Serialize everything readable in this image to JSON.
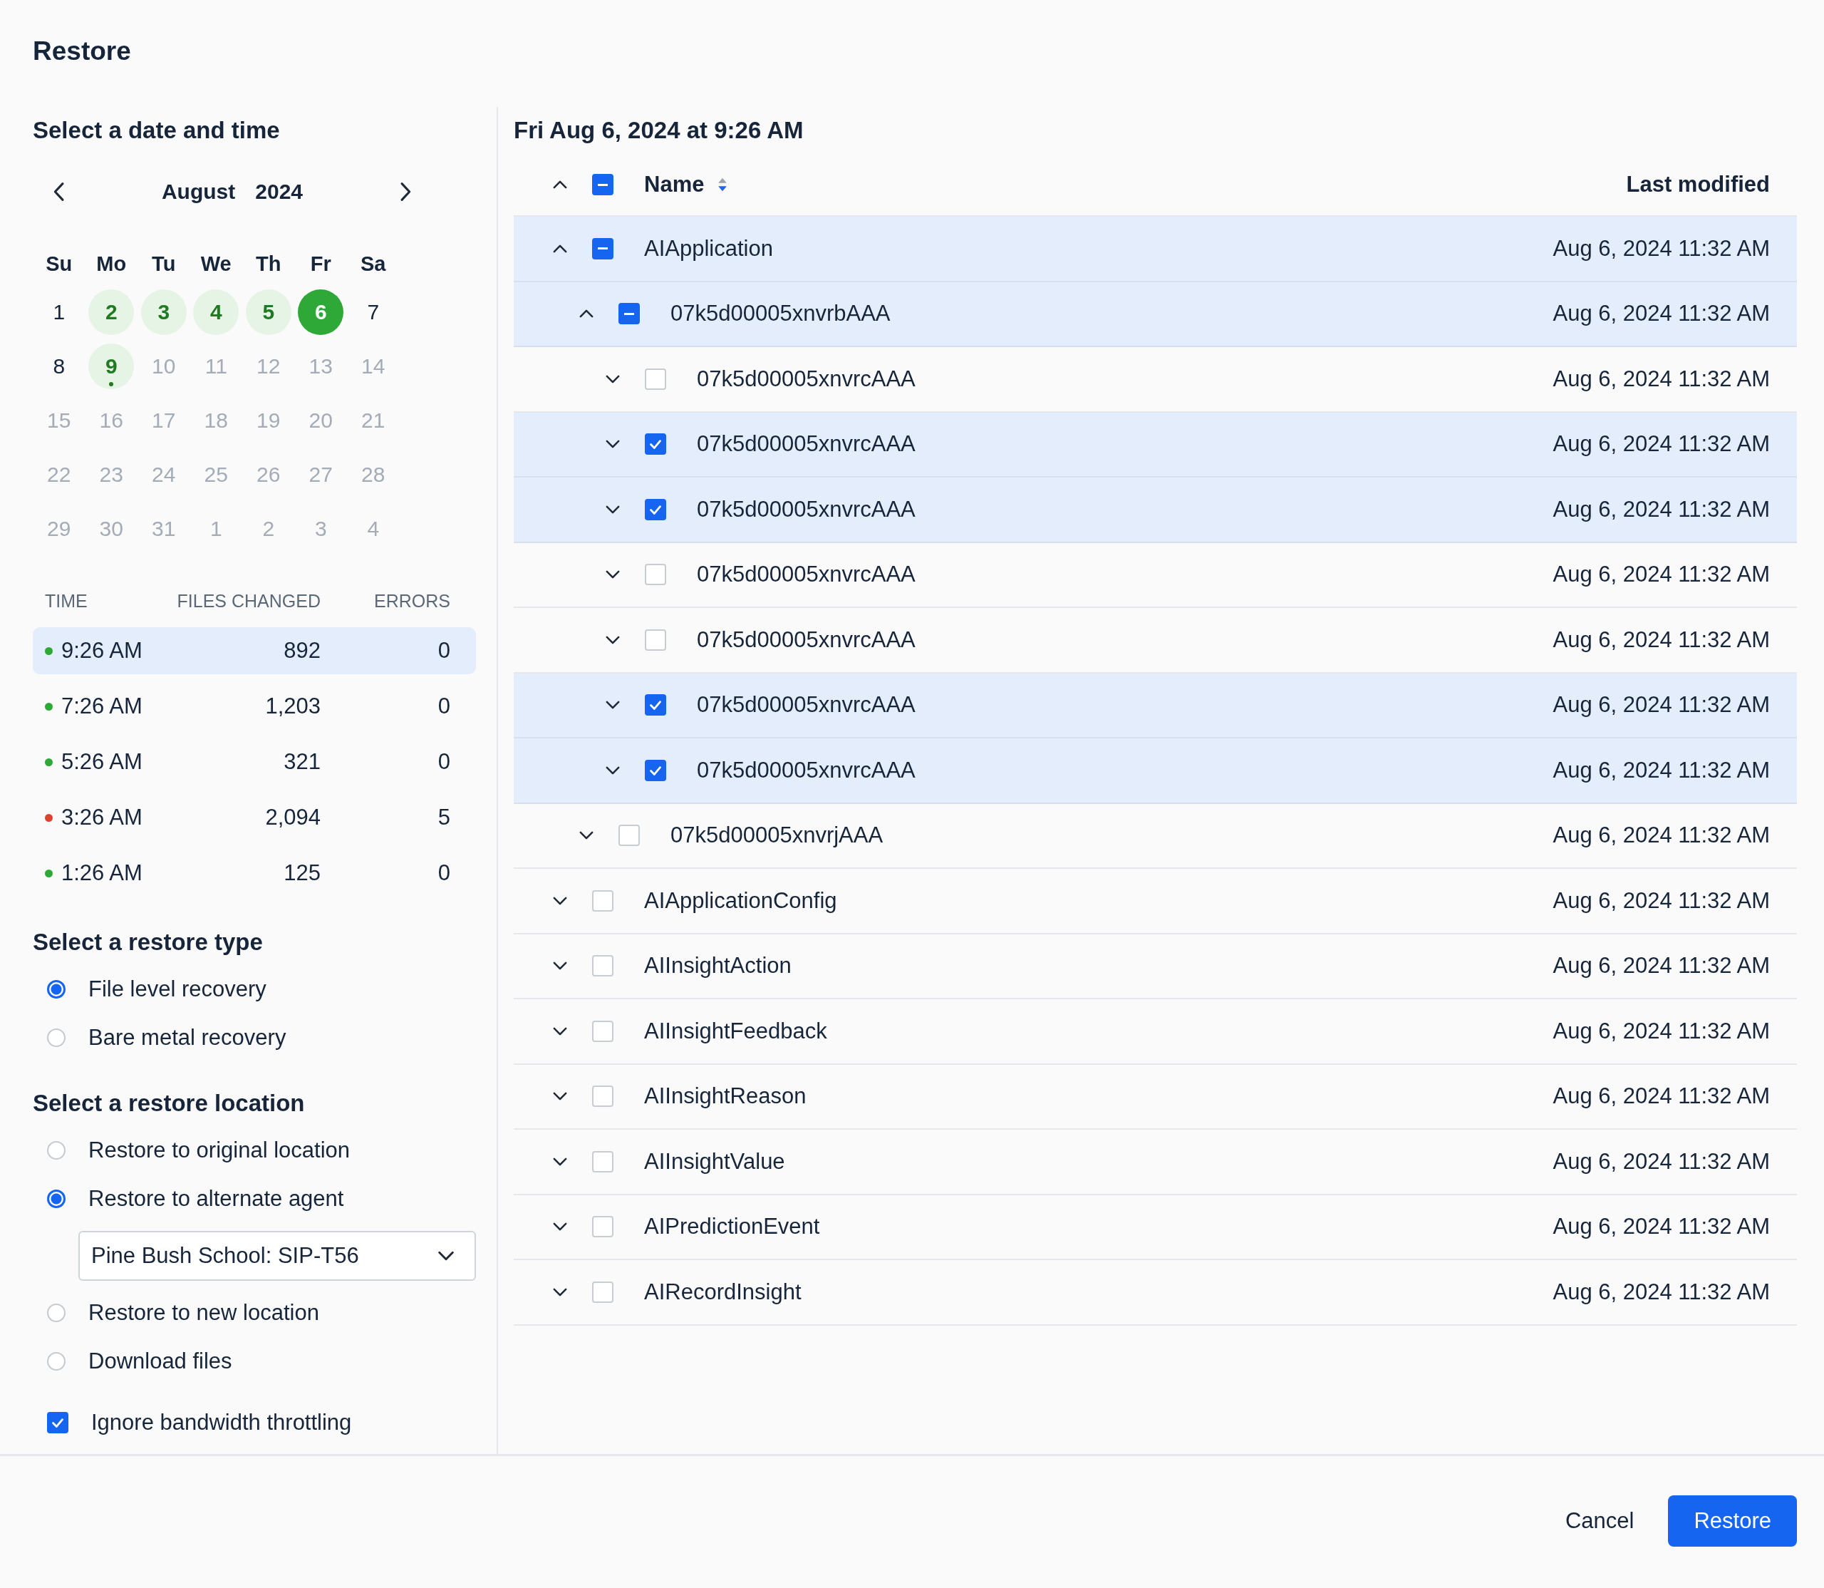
{
  "window": {
    "title": "Restore"
  },
  "date_section": {
    "heading": "Select a date and time",
    "month": "August",
    "year": "2024",
    "weekdays": [
      "Su",
      "Mo",
      "Tu",
      "We",
      "Th",
      "Fr",
      "Sa"
    ],
    "weeks": [
      [
        {
          "label": "1",
          "disabled": false,
          "has_backups": false,
          "selected": false,
          "today": false
        },
        {
          "label": "2",
          "disabled": false,
          "has_backups": true,
          "selected": false,
          "today": false
        },
        {
          "label": "3",
          "disabled": false,
          "has_backups": true,
          "selected": false,
          "today": false
        },
        {
          "label": "4",
          "disabled": false,
          "has_backups": true,
          "selected": false,
          "today": false
        },
        {
          "label": "5",
          "disabled": false,
          "has_backups": true,
          "selected": false,
          "today": false
        },
        {
          "label": "6",
          "disabled": false,
          "has_backups": true,
          "selected": true,
          "today": false
        },
        {
          "label": "7",
          "disabled": false,
          "has_backups": false,
          "selected": false,
          "today": false
        }
      ],
      [
        {
          "label": "8",
          "disabled": false,
          "has_backups": false,
          "selected": false,
          "today": false
        },
        {
          "label": "9",
          "disabled": false,
          "has_backups": true,
          "selected": false,
          "today": true
        },
        {
          "label": "10",
          "disabled": true,
          "has_backups": false,
          "selected": false,
          "today": false
        },
        {
          "label": "11",
          "disabled": true,
          "has_backups": false,
          "selected": false,
          "today": false
        },
        {
          "label": "12",
          "disabled": true,
          "has_backups": false,
          "selected": false,
          "today": false
        },
        {
          "label": "13",
          "disabled": true,
          "has_backups": false,
          "selected": false,
          "today": false
        },
        {
          "label": "14",
          "disabled": true,
          "has_backups": false,
          "selected": false,
          "today": false
        }
      ],
      [
        {
          "label": "15",
          "disabled": true,
          "has_backups": false,
          "selected": false,
          "today": false
        },
        {
          "label": "16",
          "disabled": true,
          "has_backups": false,
          "selected": false,
          "today": false
        },
        {
          "label": "17",
          "disabled": true,
          "has_backups": false,
          "selected": false,
          "today": false
        },
        {
          "label": "18",
          "disabled": true,
          "has_backups": false,
          "selected": false,
          "today": false
        },
        {
          "label": "19",
          "disabled": true,
          "has_backups": false,
          "selected": false,
          "today": false
        },
        {
          "label": "20",
          "disabled": true,
          "has_backups": false,
          "selected": false,
          "today": false
        },
        {
          "label": "21",
          "disabled": true,
          "has_backups": false,
          "selected": false,
          "today": false
        }
      ],
      [
        {
          "label": "22",
          "disabled": true,
          "has_backups": false,
          "selected": false,
          "today": false
        },
        {
          "label": "23",
          "disabled": true,
          "has_backups": false,
          "selected": false,
          "today": false
        },
        {
          "label": "24",
          "disabled": true,
          "has_backups": false,
          "selected": false,
          "today": false
        },
        {
          "label": "25",
          "disabled": true,
          "has_backups": false,
          "selected": false,
          "today": false
        },
        {
          "label": "26",
          "disabled": true,
          "has_backups": false,
          "selected": false,
          "today": false
        },
        {
          "label": "27",
          "disabled": true,
          "has_backups": false,
          "selected": false,
          "today": false
        },
        {
          "label": "28",
          "disabled": true,
          "has_backups": false,
          "selected": false,
          "today": false
        }
      ],
      [
        {
          "label": "29",
          "disabled": true,
          "has_backups": false,
          "selected": false,
          "today": false
        },
        {
          "label": "30",
          "disabled": true,
          "has_backups": false,
          "selected": false,
          "today": false
        },
        {
          "label": "31",
          "disabled": true,
          "has_backups": false,
          "selected": false,
          "today": false
        },
        {
          "label": "1",
          "disabled": true,
          "has_backups": false,
          "selected": false,
          "today": false
        },
        {
          "label": "2",
          "disabled": true,
          "has_backups": false,
          "selected": false,
          "today": false
        },
        {
          "label": "3",
          "disabled": true,
          "has_backups": false,
          "selected": false,
          "today": false
        },
        {
          "label": "4",
          "disabled": true,
          "has_backups": false,
          "selected": false,
          "today": false
        }
      ]
    ]
  },
  "snapshots": {
    "columns": [
      "TIME",
      "FILES CHANGED",
      "ERRORS"
    ],
    "rows": [
      {
        "time": "9:26 AM",
        "files_changed": "892",
        "errors": "0",
        "color": "#2ea836",
        "selected": true
      },
      {
        "time": "7:26 AM",
        "files_changed": "1,203",
        "errors": "0",
        "color": "#2ea836",
        "selected": false
      },
      {
        "time": "5:26 AM",
        "files_changed": "321",
        "errors": "0",
        "color": "#2ea836",
        "selected": false
      },
      {
        "time": "3:26 AM",
        "files_changed": "2,094",
        "errors": "5",
        "color": "#d9432f",
        "selected": false
      },
      {
        "time": "1:26 AM",
        "files_changed": "125",
        "errors": "0",
        "color": "#2ea836",
        "selected": false
      }
    ]
  },
  "restore_type": {
    "heading": "Select a restore type",
    "options": [
      {
        "label": "File level recovery",
        "selected": true
      },
      {
        "label": "Bare metal recovery",
        "selected": false
      }
    ]
  },
  "restore_location": {
    "heading": "Select a restore location",
    "options": [
      {
        "label": "Restore to original location",
        "selected": false
      },
      {
        "label": "Restore to alternate agent",
        "selected": true,
        "dropdown": "Pine Bush School: SIP-T56"
      },
      {
        "label": "Restore to new location",
        "selected": false
      },
      {
        "label": "Download files",
        "selected": false
      }
    ]
  },
  "ignore_throttling": {
    "label": "Ignore bandwidth throttling",
    "checked": true
  },
  "file_tree": {
    "heading": "Fri Aug 6, 2024 at 9:26 AM",
    "header": {
      "expanded": true,
      "checked": true,
      "partial": true,
      "name": "Name",
      "last_modified": "Last modified"
    },
    "items": [
      {
        "name": "AIApplication",
        "modified": "Aug 6, 2024 11:32 AM",
        "expanded": true,
        "checked": true,
        "partial": true,
        "children": [
          {
            "name": "07k5d00005xnvrbAAA",
            "modified": "Aug 6, 2024 11:32 AM",
            "expanded": true,
            "checked": true,
            "partial": true,
            "children": [
              {
                "name": "07k5d00005xnvrcAAA",
                "modified": "Aug 6, 2024 11:32 AM",
                "expanded": false,
                "checked": false,
                "partial": false
              },
              {
                "name": "07k5d00005xnvrcAAA",
                "modified": "Aug 6, 2024 11:32 AM",
                "expanded": false,
                "checked": true,
                "partial": false
              },
              {
                "name": "07k5d00005xnvrcAAA",
                "modified": "Aug 6, 2024 11:32 AM",
                "expanded": false,
                "checked": true,
                "partial": false
              },
              {
                "name": "07k5d00005xnvrcAAA",
                "modified": "Aug 6, 2024 11:32 AM",
                "expanded": false,
                "checked": false,
                "partial": false
              },
              {
                "name": "07k5d00005xnvrcAAA",
                "modified": "Aug 6, 2024 11:32 AM",
                "expanded": false,
                "checked": false,
                "partial": false
              },
              {
                "name": "07k5d00005xnvrcAAA",
                "modified": "Aug 6, 2024 11:32 AM",
                "expanded": false,
                "checked": true,
                "partial": false
              },
              {
                "name": "07k5d00005xnvrcAAA",
                "modified": "Aug 6, 2024 11:32 AM",
                "expanded": false,
                "checked": true,
                "partial": false
              }
            ]
          },
          {
            "name": "07k5d00005xnvrjAAA",
            "modified": "Aug 6, 2024 11:32 AM",
            "expanded": false,
            "checked": false,
            "partial": false
          }
        ]
      },
      {
        "name": "AIApplicationConfig",
        "modified": "Aug 6, 2024 11:32 AM",
        "expanded": false,
        "checked": false,
        "partial": false
      },
      {
        "name": "AIInsightAction",
        "modified": "Aug 6, 2024 11:32 AM",
        "expanded": false,
        "checked": false,
        "partial": false
      },
      {
        "name": "AIInsightFeedback",
        "modified": "Aug 6, 2024 11:32 AM",
        "expanded": false,
        "checked": false,
        "partial": false
      },
      {
        "name": "AIInsightReason",
        "modified": "Aug 6, 2024 11:32 AM",
        "expanded": false,
        "checked": false,
        "partial": false
      },
      {
        "name": "AIInsightValue",
        "modified": "Aug 6, 2024 11:32 AM",
        "expanded": false,
        "checked": false,
        "partial": false
      },
      {
        "name": "AIPredictionEvent",
        "modified": "Aug 6, 2024 11:32 AM",
        "expanded": false,
        "checked": false,
        "partial": false
      },
      {
        "name": "AIRecordInsight",
        "modified": "Aug 6, 2024 11:32 AM",
        "expanded": false,
        "checked": false,
        "partial": false
      }
    ]
  },
  "buttons": [
    {
      "label": "Cancel",
      "kind": "secondary"
    },
    {
      "label": "Restore",
      "kind": "primary"
    }
  ]
}
